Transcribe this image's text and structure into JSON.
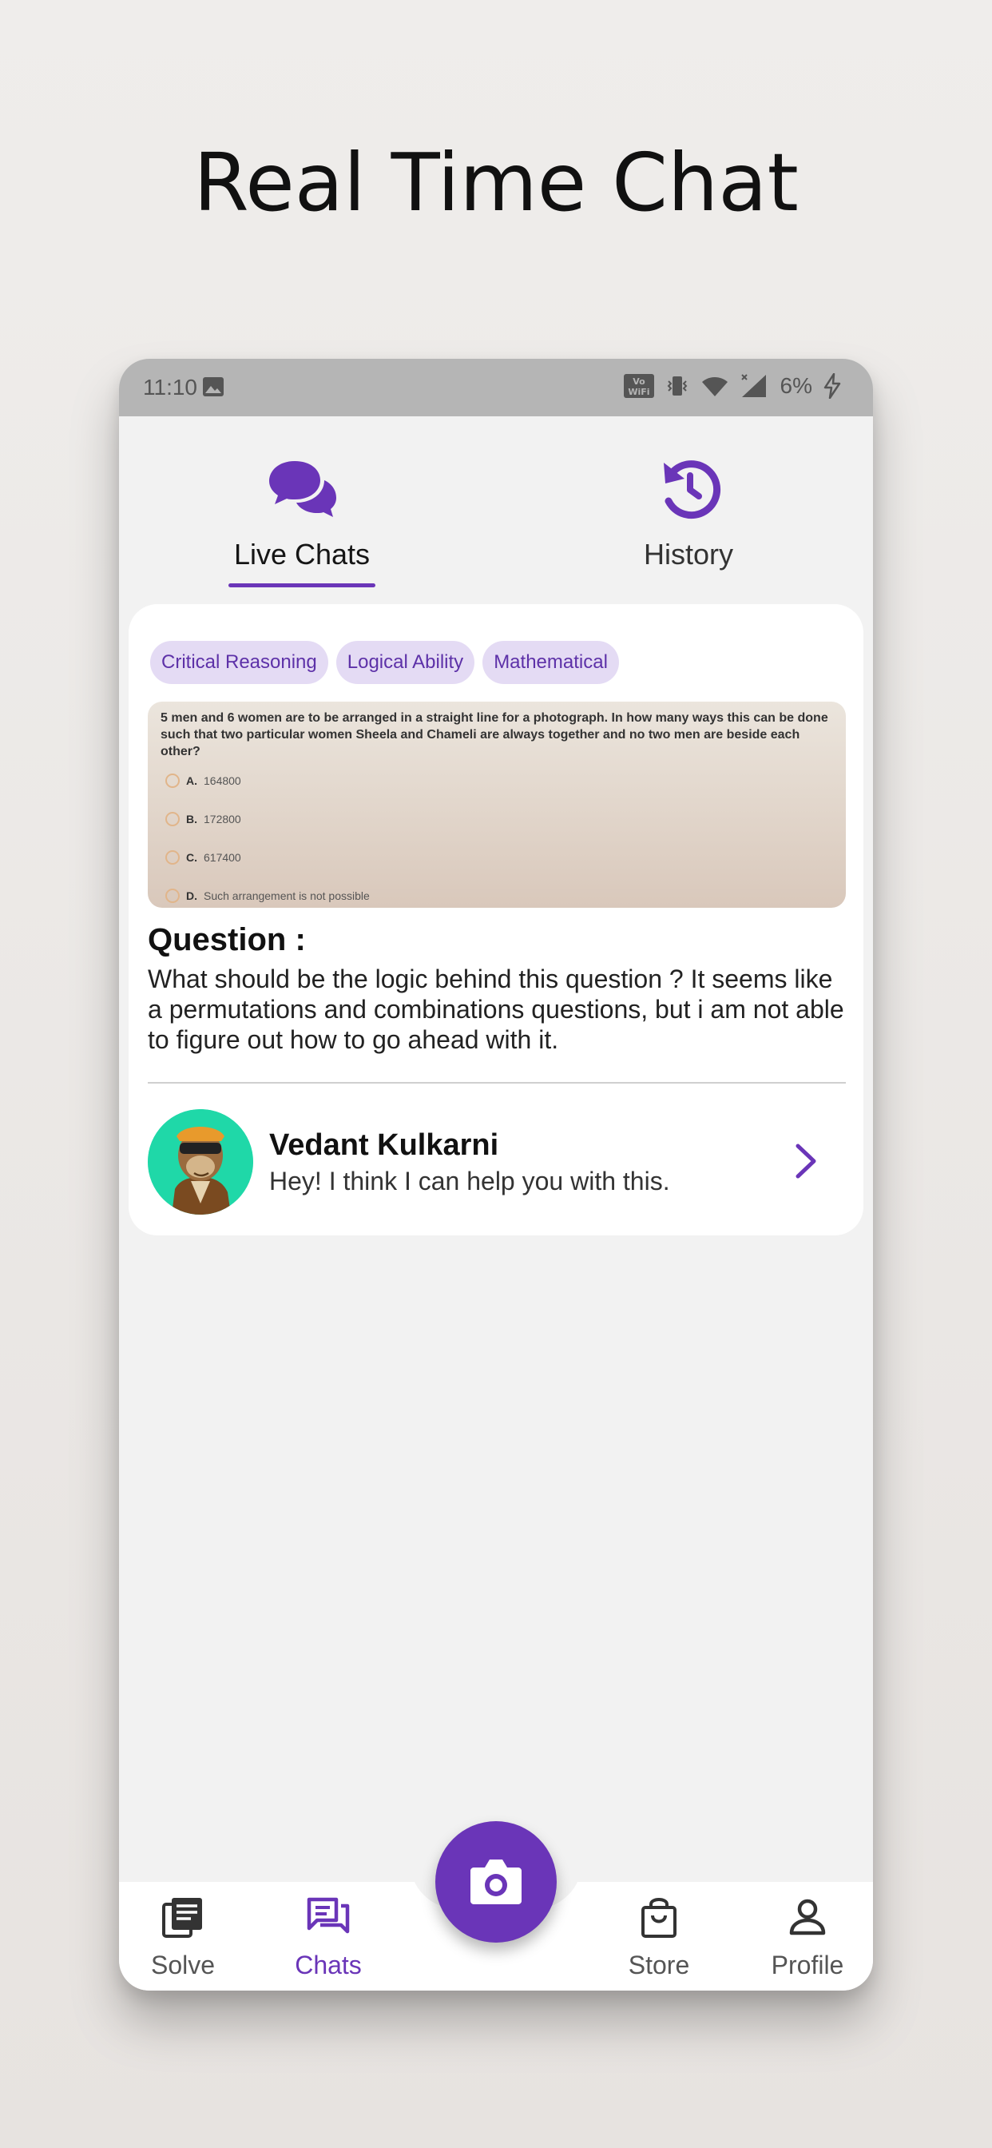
{
  "headline": "Real Time Chat",
  "status_bar": {
    "time": "11:10",
    "battery": "6%",
    "icons": [
      "image-icon",
      "vowifi-icon",
      "vibrate-icon",
      "wifi-icon",
      "signal-icon",
      "charging-icon"
    ]
  },
  "tabs": [
    {
      "label": "Live Chats",
      "icon": "chat-bubbles-icon",
      "active": true
    },
    {
      "label": "History",
      "icon": "history-icon",
      "active": false
    }
  ],
  "question_card": {
    "chips": [
      "Critical Reasoning",
      "Logical Ability",
      "Mathematical"
    ],
    "image": {
      "question": "5 men and 6 women are to be arranged in a straight line for a photograph. In how many ways this can be done such that two particular women Sheela and Chameli are always together and no two men are beside each other?",
      "options": [
        {
          "key": "A.",
          "text": "164800"
        },
        {
          "key": "B.",
          "text": "172800"
        },
        {
          "key": "C.",
          "text": "617400"
        },
        {
          "key": "D.",
          "text": "Such arrangement is not possible"
        }
      ]
    },
    "title": "Question :",
    "body": "What should be the logic behind this question ? It seems like a permutations and combinations questions, but i am not able to figure out how to go ahead with it.",
    "helper": {
      "name": "Vedant Kulkarni",
      "message": "Hey! I think I can help you with this."
    }
  },
  "bottom_nav": [
    {
      "label": "Solve",
      "icon": "document-icon",
      "active": false
    },
    {
      "label": "Chats",
      "icon": "chats-icon",
      "active": true
    },
    {
      "label": "Store",
      "icon": "shopping-bag-icon",
      "active": false
    },
    {
      "label": "Profile",
      "icon": "person-icon",
      "active": false
    }
  ],
  "fab": {
    "icon": "camera-icon"
  },
  "colors": {
    "accent": "#6a35b8",
    "chip_bg": "#e4dbf4",
    "avatar_bg": "#1fd8a8"
  }
}
